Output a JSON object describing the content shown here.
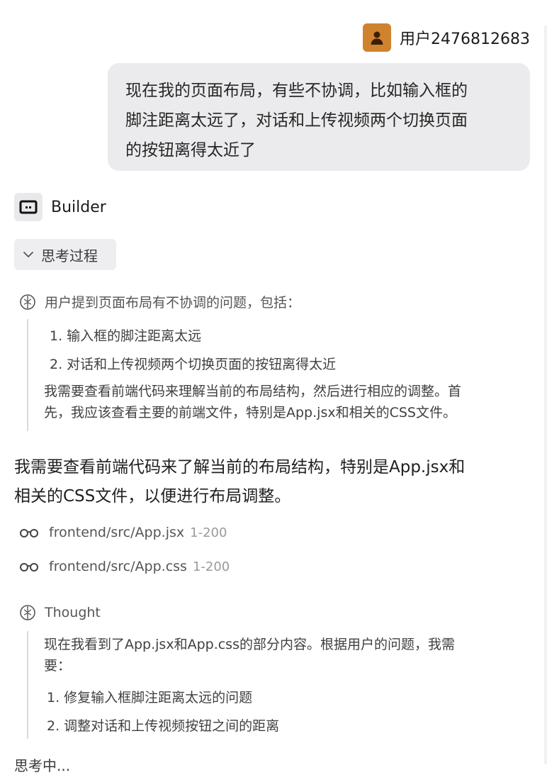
{
  "user": {
    "name": "用户2476812683",
    "avatar_icon": "person-icon",
    "avatar_color": "#d0832f"
  },
  "user_message": {
    "lines": [
      "现在我的页面布局，有些不协调，比如输入框的",
      "脚注距离太远了，对话和上传视频两个切换页面",
      "的按钮离得太近了"
    ]
  },
  "agent": {
    "name": "Builder",
    "icon": "builder-icon"
  },
  "thinking_toggle": {
    "label": "思考过程",
    "icon": "chevron-down-icon",
    "expanded": true
  },
  "thought1": {
    "icon": "brain-icon",
    "heading": "用户提到页面布局有不协调的问题，包括：",
    "items": [
      "1. 输入框的脚注距离太远",
      "2. 对话和上传视频两个切换页面的按钮离得太近"
    ],
    "note_lines": [
      "我需要查看前端代码来理解当前的布局结构，然后进行相应的调整。首",
      "先，我应该查看主要的前端文件，特别是App.jsx和相关的CSS文件。"
    ]
  },
  "response": {
    "lines": [
      "我需要查看前端代码来了解当前的布局结构，特别是App.jsx和",
      "相关的CSS文件，以便进行布局调整。"
    ]
  },
  "file_reads": [
    {
      "icon": "glasses-icon",
      "path": "frontend/src/App.jsx",
      "range": "1-200"
    },
    {
      "icon": "glasses-icon",
      "path": "frontend/src/App.css",
      "range": "1-200"
    }
  ],
  "thought2": {
    "icon": "brain-icon",
    "heading": "Thought",
    "intro_lines": [
      "现在我看到了App.jsx和App.css的部分内容。根据用户的问题，我需",
      "要："
    ],
    "items": [
      "1. 修复输入框脚注距离太远的问题",
      "2. 调整对话和上传视频按钮之间的距离"
    ]
  },
  "status": {
    "text": "思考中..."
  }
}
